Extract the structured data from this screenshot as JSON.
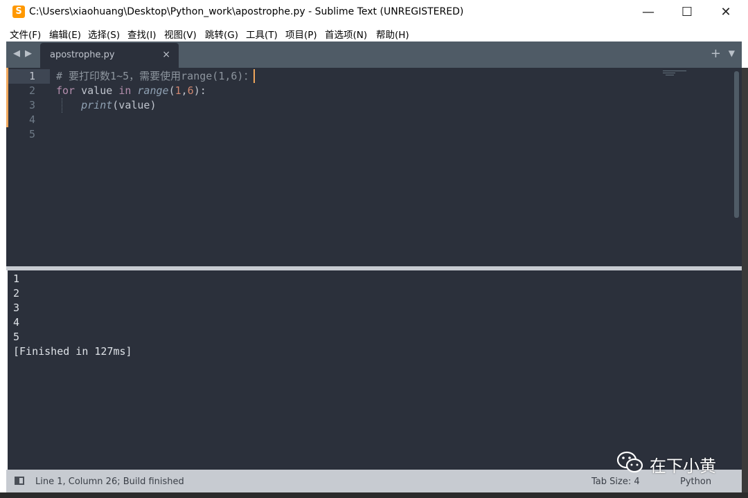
{
  "window": {
    "app_icon": "sublime-text-icon",
    "app_icon_glyph": "S",
    "title": "C:\\Users\\xiaohuang\\Desktop\\Python_work\\apostrophe.py - Sublime Text (UNREGISTERED)",
    "minimize_icon": "—",
    "maximize_icon": "☐",
    "close_icon": "✕"
  },
  "menu": {
    "items": [
      "文件(F)",
      "编辑(E)",
      "选择(S)",
      "查找(I)",
      "视图(V)",
      "跳转(G)",
      "工具(T)",
      "项目(P)",
      "首选项(N)",
      "帮助(H)"
    ]
  },
  "tabs": {
    "nav_left": "◀",
    "nav_right": "▶",
    "active_tab": "apostrophe.py",
    "close_glyph": "×",
    "new_tab_glyph": "+",
    "menu_glyph": "▼"
  },
  "editor": {
    "line_numbers": [
      "1",
      "2",
      "3",
      "4",
      "5"
    ],
    "line1": {
      "comment": "# 要打印数1~5，需要使用range(1,6)："
    },
    "line2": {
      "kw_for": "for",
      "var_value": " value ",
      "kw_in": "in",
      "space": " ",
      "fn_range": "range",
      "paren_open": "(",
      "num1": "1",
      "comma": ",",
      "num2": "6",
      "paren_close": "):"
    },
    "line3": {
      "indent": "    ",
      "fn_print": "print",
      "args": "(value)"
    }
  },
  "output": {
    "lines": [
      "1",
      "2",
      "3",
      "4",
      "5",
      "[Finished in 127ms]"
    ]
  },
  "status": {
    "left": "Line 1, Column 26; Build finished",
    "tab_size": "Tab Size: 4",
    "syntax": "Python"
  },
  "watermark": {
    "icon": "wechat-icon",
    "text": "在下小黄"
  },
  "colors": {
    "editor_bg": "#2b303b",
    "keyword": "#b48ead",
    "function": "#8fa1b3",
    "number": "#d08770",
    "comment": "#8d959e",
    "accent": "#f0a75c"
  }
}
